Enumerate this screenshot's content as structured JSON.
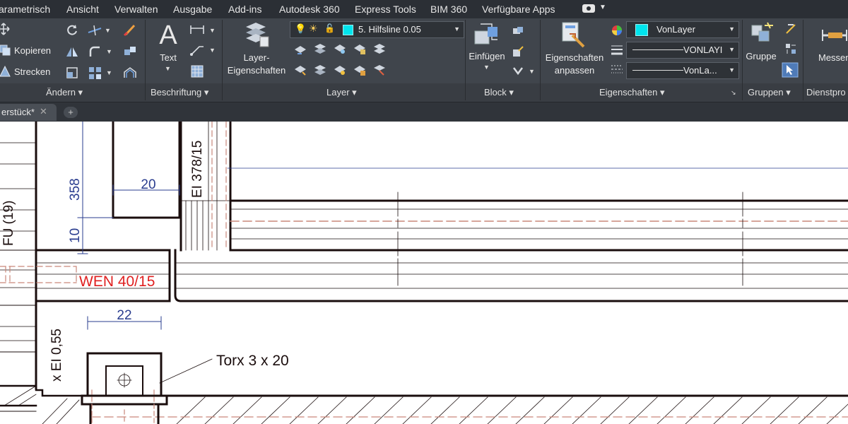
{
  "menu": {
    "items": [
      "arametrisch",
      "Ansicht",
      "Verwalten",
      "Ausgabe",
      "Add-ins",
      "Autodesk 360",
      "Express Tools",
      "BIM 360",
      "Verfügbare Apps"
    ]
  },
  "ribbon": {
    "aendern": {
      "copy_label": "Kopieren",
      "stretch_label": "Strecken",
      "title": "Ändern"
    },
    "beschriftung": {
      "text_label": "Text",
      "title": "Beschriftung"
    },
    "layer": {
      "props_label_line1": "Layer-",
      "props_label_line2": "Eigenschaften",
      "current_layer": "5. Hilfsline 0.05",
      "title": "Layer"
    },
    "block": {
      "insert_label": "Einfügen",
      "title": "Block"
    },
    "eigenschaften": {
      "match_label_line1": "Eigenschaften",
      "match_label_line2": "anpassen",
      "color_value": "VonLayer",
      "linetype_value": "VONLAYI",
      "lineweight_value": "VonLa...",
      "title": "Eigenschaften"
    },
    "gruppen": {
      "group_label": "Gruppe",
      "title": "Gruppen"
    },
    "dienstprogramme": {
      "measure_label": "Messen",
      "title": "Dienstpro"
    }
  },
  "tabs": {
    "document": "erstück*",
    "close": "✕",
    "new": "+"
  },
  "drawing": {
    "dim_20": "20",
    "dim_358": "358",
    "dim_10": "10",
    "dim_22": "22",
    "label_ei_378": "EI 378/15",
    "label_wen": "WEN 40/15",
    "label_fu": "FU (19)",
    "label_ei_055": "x EI 0,55",
    "label_torx": "Torx 3 x 20",
    "colors": {
      "dimension": "#2a3d8f",
      "callout_red": "#e02020",
      "hidden": "#c9877a",
      "outline": "#1a0d0d"
    }
  },
  "colors": {
    "ribbon_bg": "#40454c",
    "menubar_bg": "#2b2f35",
    "accent_cyan": "#00e5ee"
  }
}
